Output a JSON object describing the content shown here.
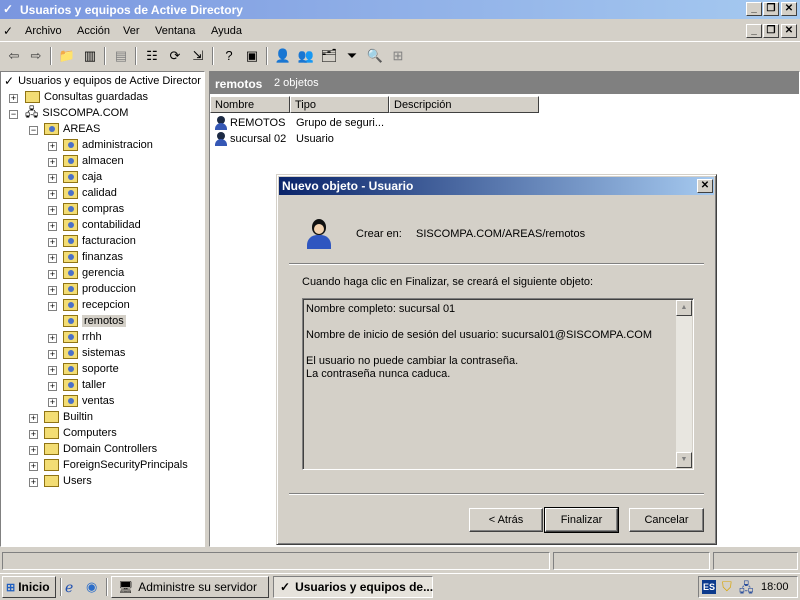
{
  "window": {
    "title": "Usuarios y equipos de Active Directory"
  },
  "menu": {
    "items": [
      "Archivo",
      "Acción",
      "Ver",
      "Ventana",
      "Ayuda"
    ]
  },
  "toolbar": {
    "icons": [
      "back-arrow-icon",
      "forward-arrow-icon",
      "up-folder-icon",
      "show-tree-icon",
      "delete-icon",
      "properties-icon",
      "refresh-icon",
      "export-icon",
      "help-icon",
      "console-icon",
      "new-user-icon",
      "new-group-icon",
      "new-ou-icon",
      "filter-icon",
      "find-icon",
      "add-to-group-icon"
    ]
  },
  "tree": {
    "root": "Usuarios y equipos de Active Director",
    "saved_queries": "Consultas guardadas",
    "domain": "SISCOMPA.COM",
    "areas": "AREAS",
    "ous": [
      "administracion",
      "almacen",
      "caja",
      "calidad",
      "compras",
      "contabilidad",
      "facturacion",
      "finanzas",
      "gerencia",
      "produccion",
      "recepcion",
      "remotos",
      "rrhh",
      "sistemas",
      "soporte",
      "taller",
      "ventas"
    ],
    "selected": "remotos",
    "containers": [
      "Builtin",
      "Computers",
      "Domain Controllers",
      "ForeignSecurityPrincipals",
      "Users"
    ]
  },
  "right": {
    "title": "remotos",
    "count": "2 objetos",
    "columns": [
      "Nombre",
      "Tipo",
      "Descripción"
    ],
    "rows": [
      {
        "name": "REMOTOS",
        "type": "Grupo de seguri..."
      },
      {
        "name": "sucursal 02",
        "type": "Usuario"
      }
    ]
  },
  "dialog": {
    "title": "Nuevo objeto - Usuario",
    "create_label": "Crear en:",
    "create_path": "SISCOMPA.COM/AREAS/remotos",
    "intro": "Cuando haga clic en Finalizar, se creará el siguiente objeto:",
    "summary": "Nombre completo: sucursal 01\n\nNombre de inicio de sesión del usuario: sucursal01@SISCOMPA.COM\n\nEl usuario no puede cambiar la contraseña.\nLa contraseña nunca caduca.",
    "back": "< Atrás",
    "finish": "Finalizar",
    "cancel": "Cancelar"
  },
  "taskbar": {
    "start": "Inicio",
    "tasks": [
      "Administre su servidor",
      "Usuarios y equipos de..."
    ],
    "lang": "ES",
    "clock": "18:00"
  }
}
